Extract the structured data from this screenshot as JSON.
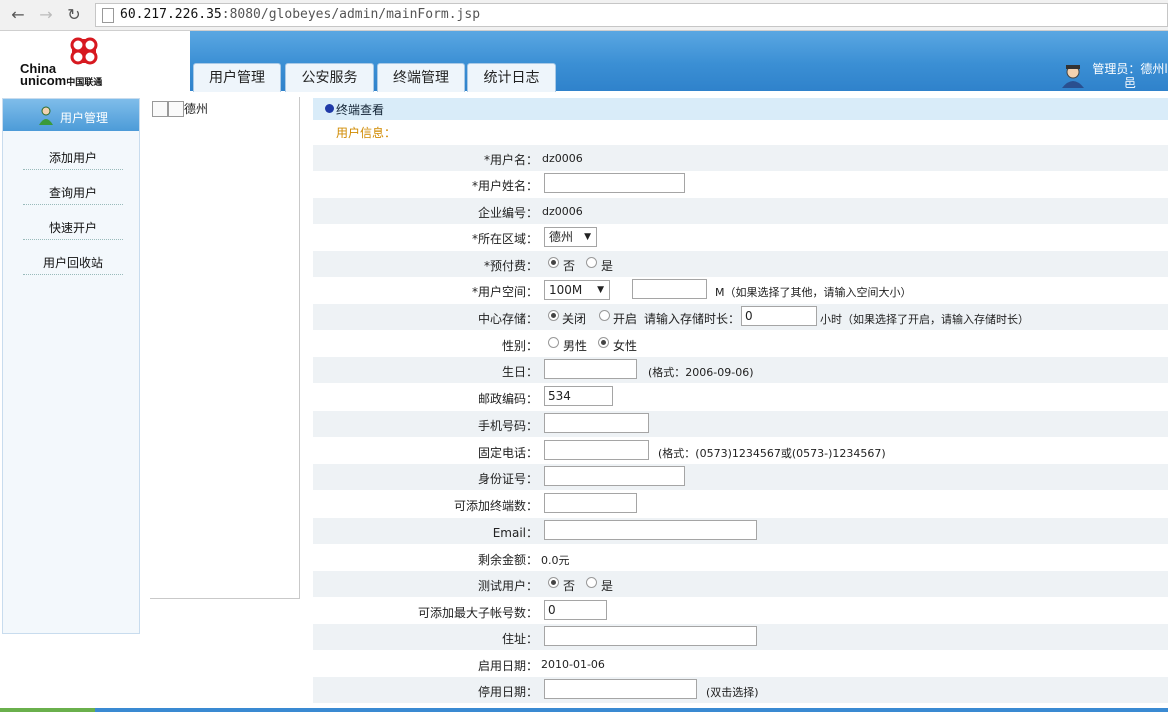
{
  "browser": {
    "url_host": "60.217.226.35",
    "url_rest": ":8080/globeyes/admin/mainForm.jsp"
  },
  "header": {
    "logo_text_top": "China",
    "logo_text_bottom": "unicom",
    "logo_text_cn": "中国联通",
    "tabs": [
      "用户管理",
      "公安服务",
      "终端管理",
      "统计日志"
    ],
    "admin_label": "管理员：德州l邑"
  },
  "sidebar": {
    "title": "用户管理",
    "items": [
      "添加用户",
      "查询用户",
      "快速开户",
      "用户回收站"
    ]
  },
  "tree": {
    "node": "德州"
  },
  "form": {
    "section_title": "终端查看",
    "subsection": "用户信息：",
    "username_label": "*用户名：",
    "username_value": "dz0006",
    "fullname_label": "*用户姓名：",
    "fullname_value": "",
    "company_label": "企业编号：",
    "company_value": "dz0006",
    "area_label": "*所在区域：",
    "area_value": "德州",
    "prepaid_label": "*预付费：",
    "prepaid_no": "否",
    "prepaid_yes": "是",
    "space_label": "*用户空间：",
    "space_value": "100M",
    "space_note": "M（如果选择了其他，请输入空间大小）",
    "storage_label": "中心存储：",
    "storage_off": "关闭",
    "storage_on": "开启",
    "storage_prompt": "请输入存储时长：",
    "storage_value": "0",
    "storage_note": "小时（如果选择了开启，请输入存储时长）",
    "gender_label": "性别：",
    "gender_male": "男性",
    "gender_female": "女性",
    "birthday_label": "生日：",
    "birthday_note": "(格式：2006-09-06)",
    "zip_label": "邮政编码：",
    "zip_value": "534",
    "mobile_label": "手机号码：",
    "phone_label": "固定电话：",
    "phone_note": "(格式：(0573)1234567或(0573-)1234567)",
    "id_label": "身份证号：",
    "terminals_label": "可添加终端数：",
    "email_label": "Email：",
    "balance_label": "剩余金额：",
    "balance_value": "0.0元",
    "test_label": "测试用户：",
    "test_no": "否",
    "test_yes": "是",
    "subaccounts_label": "可添加最大子帐号数：",
    "subaccounts_value": "0",
    "address_label": "住址：",
    "start_label": "启用日期：",
    "start_value": "2010-01-06",
    "stop_label": "停用日期：",
    "stop_note": "(双击选择)"
  }
}
